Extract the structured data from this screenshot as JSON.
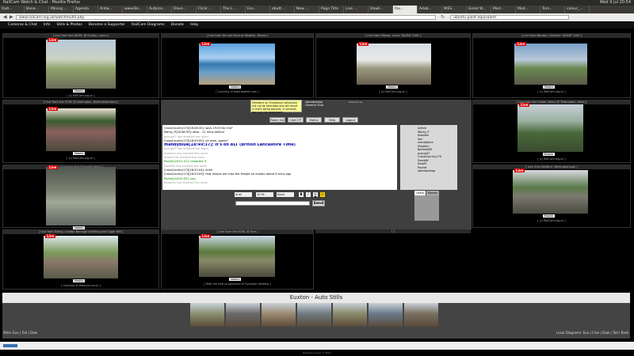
{
  "window": {
    "title": "RailCam Watch & Chat - Mozilla Firefox",
    "clock": "Wed 9 Jul 20:54"
  },
  "tabs": [
    "Outl...",
    "Bane...",
    "Mining ...",
    "Agenda",
    " Antw...",
    "www.Be...",
    "Aufpres...",
    "Dave...",
    "Flickr:...",
    "The L...",
    "Ess...",
    "ebutt...",
    "New ...",
    "Page Title",
    "Live ...",
    "Dawli...",
    "Rai...",
    "Adob...",
    "WES...",
    "Great W...",
    "Mod...",
    "Mod...",
    "Torn...",
    "colour_..."
  ],
  "active_tab": 16,
  "url": "www.railcam.org.uk/watchmultil.php",
  "search": "ubuntu paint equivalent",
  "site_menu": [
    "Cameras & Chat",
    "Info",
    "Stills & Photos",
    "Become a Supporter",
    "RailCam Diagrams",
    "Donate",
    "Help"
  ],
  "live_label": "Live",
  "mobile_label": "Mobile",
  "cameras": [
    {
      "caption": "[ Live from the WCML @ Euxton, Lancs ]",
      "sub": "[ (c) RailCam.org.uk ]"
    },
    {
      "caption": "[ Live from the sea front at Dawlish, Devon ]",
      "sub": "[ Courtesy of www.dawlish.com ]"
    },
    {
      "caption": "[ Live from Elbrow, Lancs 'SILENT CAM' ]",
      "sub": "[ (c) RailCam.org.uk ]"
    },
    {
      "caption": "[ Live from Barrow, Cheshire 'SILENT CAM' ]",
      "sub": "[ (c) RailCam.org.uk ]"
    },
    {
      "caption": "[ Live from the ECML @ Darlington, Northumberland ]",
      "sub": "[ (c) RailCam.org.uk ]"
    },
    {
      "caption": "[ Live from the Calder Valley @ Todmorden, Yorks ]",
      "sub": "[ (c) RailCam.org.uk ]"
    },
    {
      "caption": "[ Live from the Cornwall Valley ]",
      "sub": ""
    },
    {
      "caption": "[ Live from Bedford, Wellingborough ]",
      "sub": "[ (c) RailCam.org.uk ]"
    },
    {
      "caption": "[ Live from Ealing, London Borough of Ealing and Sugar Mill ]",
      "sub": "[ Courtesy of www.xxx.co.uk ]"
    },
    {
      "caption": "[ Live from the ECML @ York ]",
      "sub": "[ With the kind co-operation of Sylvestor Heading ]"
    }
  ],
  "chat": {
    "warning": "Members on Smooshpin behaviour will not be tolerated and will result in them being banned. IF seconds ban may be permanent",
    "channel": "standpreepp",
    "room": "General Chat",
    "powered_by": "Powered by",
    "buttons": [
      "Room List",
      "User CP",
      "Status",
      "Help",
      "Logout"
    ],
    "messages": [
      "CrossCountry170[18:48:32]: says 19:05 for me?",
      "Marky_P[18:48:33]: ditto - 11 mins behind",
      "pcoug47 has entered the room",
      "CrossCountry170[18:49:00]: oh wow...again?",
      "mandyblue[18:49:37]: It's on BLT (British Lancashire Time)",
      "pcoug47 has entered the room",
      "Stephen has entered the room",
      "StepM has entered the room",
      "Pocket[18:51:47]: restarted it",
      "DavidW has entered the room",
      "CrossCountry170[18:52:04]: ahhh",
      "CrossCountry170[18:53:09]: that means we miss the freight on euxton about 6 mins ago",
      "Pocket[18:53:35]: yep.",
      "Stephen has entered the room"
    ],
    "users": [
      "Admin",
      "Marky_P",
      "Alasdair",
      "Iain",
      "mandyblue",
      "Stephen",
      "BarrowSJR",
      "pcoug47",
      "CrossCountry170",
      "DavidW",
      "StepM",
      "Pocket",
      "standpreepp"
    ],
    "tabs": [
      "Users",
      "Rooms"
    ],
    "font": "Arial",
    "size": "10 Px",
    "color": "black",
    "send_label": "Send"
  },
  "stills": {
    "title": "Euxton - Auto Stills",
    "left_links": "Stills: Eux | Tod | Daw",
    "right_links": "Local Diagrams: Eux | Cran | Daw | Tod | Barb"
  },
  "coord_bar": "[ ]",
  "footer": "RailCam.org.uk © 2014"
}
